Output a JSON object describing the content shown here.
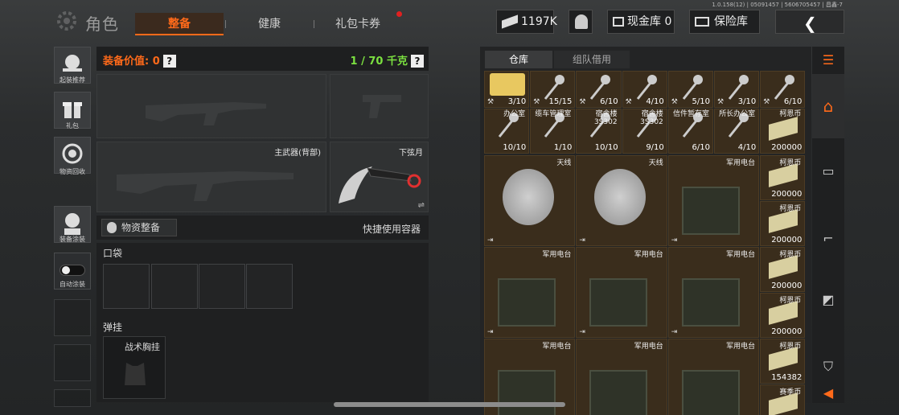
{
  "header": {
    "title": "角色",
    "tabs": [
      {
        "label": "整备"
      },
      {
        "label": "健康"
      },
      {
        "label": "礼包卡券"
      }
    ],
    "currency": "1197K",
    "cash_vault": "现金库 0",
    "safe": "保险库",
    "version": "1.0.158(12) | 05091457 | 5606705457 | 昌鑫-7"
  },
  "left_menu": [
    {
      "label": "起装推荐"
    },
    {
      "label": "礼包"
    },
    {
      "label": "物资回收"
    },
    {
      "label": "装备涂装"
    },
    {
      "label": "自动涂装"
    }
  ],
  "equip": {
    "value_label": "装备价值: 0",
    "weight": "1 / 70 千克",
    "main_weapon_back": "主武器(背部)",
    "melee_name": "下弦月",
    "supply_label": "物资整备",
    "quick_container": "快捷使用容器",
    "pocket_label": "口袋",
    "rig_label": "弹挂",
    "rig_item": "战术胸挂"
  },
  "storage": {
    "tabs": [
      {
        "label": "仓库"
      },
      {
        "label": "组队借用"
      }
    ],
    "row1": [
      "3/10",
      "15/15",
      "6/10",
      "4/10",
      "5/10",
      "3/10",
      "6/10"
    ],
    "row2": [
      {
        "name": "办公室",
        "count": "10/10"
      },
      {
        "name": "缆车管理室",
        "count": "1/10"
      },
      {
        "name": "宿舍楼\n3S302",
        "count": "10/10"
      },
      {
        "name": "宿舍楼\n3S302",
        "count": "9/10"
      },
      {
        "name": "信件暂存室",
        "count": "6/10"
      },
      {
        "name": "所长办公室",
        "count": "4/10"
      },
      {
        "name": "柯恩币",
        "count": "200000"
      }
    ],
    "big": [
      {
        "name": "天线"
      },
      {
        "name": "天线"
      },
      {
        "name": "军用电台"
      },
      {
        "name": "军用电台"
      },
      {
        "name": "军用电台"
      },
      {
        "name": "军用电台"
      },
      {
        "name": "军用电台"
      },
      {
        "name": "军用电台"
      },
      {
        "name": "军用电台"
      }
    ],
    "coins": [
      {
        "name": "柯恩币",
        "count": "200000"
      },
      {
        "name": "柯恩币",
        "count": "200000"
      },
      {
        "name": "柯恩币",
        "count": "200000"
      },
      {
        "name": "柯恩币",
        "count": "200000"
      },
      {
        "name": "柯恩币",
        "count": "154382"
      },
      {
        "name": "赛季币",
        "count": ""
      }
    ]
  },
  "colors": {
    "accent": "#ff6a1a",
    "weight": "#7be040",
    "cell": "#3a2d1c"
  }
}
